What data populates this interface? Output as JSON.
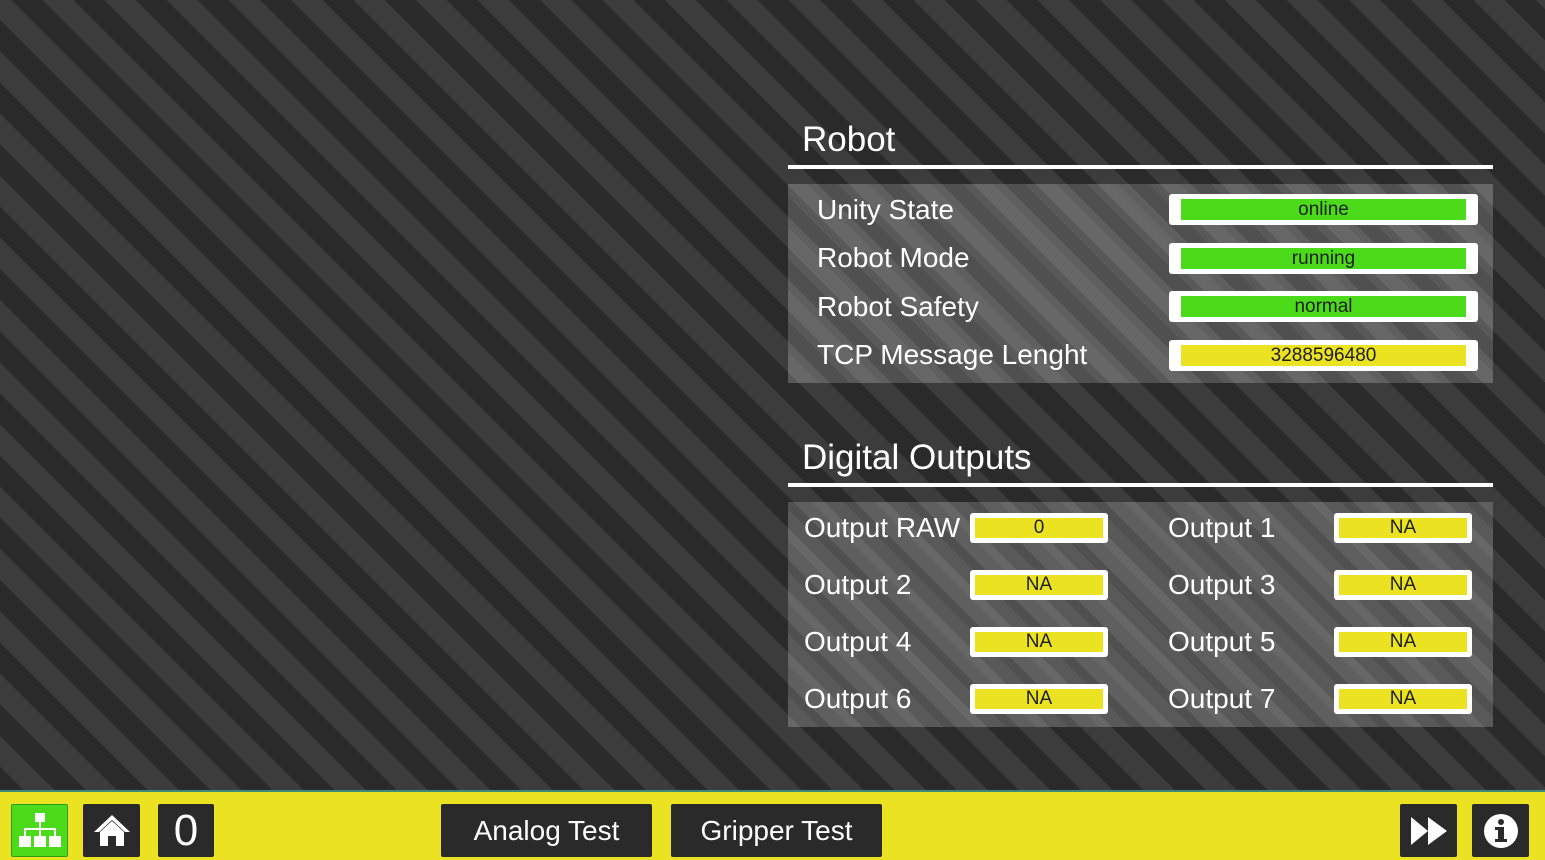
{
  "robot": {
    "title": "Robot",
    "rows": [
      {
        "label": "Unity State",
        "value": "online",
        "status": "green"
      },
      {
        "label": "Robot Mode",
        "value": "running",
        "status": "green"
      },
      {
        "label": "Robot Safety",
        "value": "normal",
        "status": "green"
      },
      {
        "label": "TCP Message Lenght",
        "value": "3288596480",
        "status": "yellow"
      }
    ]
  },
  "digital_outputs": {
    "title": "Digital Outputs",
    "items": [
      {
        "label": "Output RAW",
        "value": "0"
      },
      {
        "label": "Output 1",
        "value": "NA"
      },
      {
        "label": "Output 2",
        "value": "NA"
      },
      {
        "label": "Output 3",
        "value": "NA"
      },
      {
        "label": "Output 4",
        "value": "NA"
      },
      {
        "label": "Output 5",
        "value": "NA"
      },
      {
        "label": "Output 6",
        "value": "NA"
      },
      {
        "label": "Output 7",
        "value": "NA"
      }
    ]
  },
  "bottombar": {
    "counter": "0",
    "analog_test_label": "Analog Test",
    "gripper_test_label": "Gripper Test",
    "icons": [
      "network-icon",
      "home-icon",
      "fast-forward-icon",
      "info-icon"
    ]
  },
  "colors": {
    "green": "#4bdb1b",
    "yellow": "#ebe222",
    "bar": "#ebe222",
    "network_button": "#4bdb1b"
  }
}
